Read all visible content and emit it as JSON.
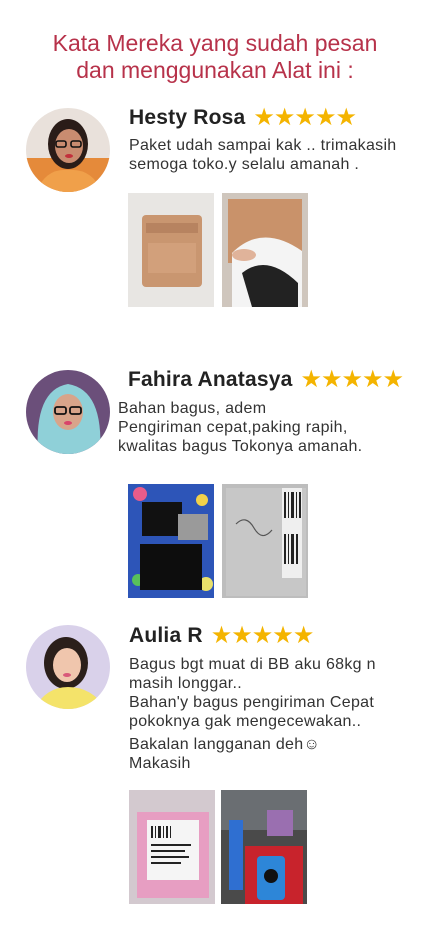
{
  "headline": {
    "line1": "Kata Mereka yang sudah pesan",
    "line2": "dan menggunakan Alat ini :"
  },
  "colors": {
    "headline": "#b7324a",
    "star": "#f4b400"
  },
  "reviews": [
    {
      "name": "Hesty Rosa",
      "stars": "★★★★★",
      "lines": [
        "Paket udah sampai kak .. trimakasih",
        "semoga toko.y selalu amanah ."
      ]
    },
    {
      "name": "Fahira Anatasya",
      "stars": "★★★★★",
      "lines": [
        "Bahan bagus, adem",
        "Pengiriman cepat,paking rapih,",
        "kwalitas bagus Tokonya amanah."
      ]
    },
    {
      "name": "Aulia R",
      "stars": "★★★★★",
      "lines": [
        "Bagus bgt muat di BB aku 68kg n",
        "masih longgar..",
        "Bahan'y bagus pengiriman Cepat",
        "pokoknya gak mengecewakan..",
        "Bakalan langganan deh☺",
        "Makasih"
      ]
    }
  ]
}
